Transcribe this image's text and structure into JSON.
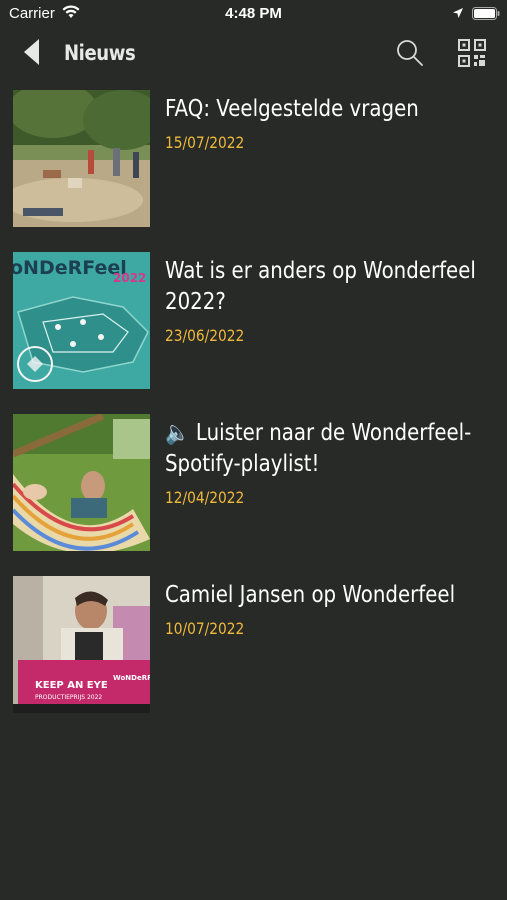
{
  "status_bar": {
    "carrier": "Carrier",
    "time": "4:48 PM"
  },
  "nav": {
    "title": "Nieuws"
  },
  "colors": {
    "background": "#282a28",
    "date": "#f0b93a",
    "text": "#ffffff"
  },
  "icons": {
    "back": "chevron-left-icon",
    "search": "search-icon",
    "qr": "qr-code-icon"
  },
  "news": [
    {
      "title": "FAQ: Veelgestelde vragen",
      "date": "15/07/2022"
    },
    {
      "title": "Wat is er anders op Wonderfeel 2022?",
      "date": "23/06/2022"
    },
    {
      "title": "🔈 Luister naar de Wonderfeel-Spotify-playlist!",
      "date": "12/04/2022"
    },
    {
      "title": "Camiel Jansen op Wonderfeel",
      "date": "10/07/2022"
    }
  ],
  "thumb_texts": {
    "map_logo": "oNDeRFeel",
    "map_year": "2022",
    "sign_line1": "KEEP AN EYE",
    "sign_line2": "PRODUCTIEPRIJS 2022",
    "sign_logo": "WoNDeRFe"
  }
}
